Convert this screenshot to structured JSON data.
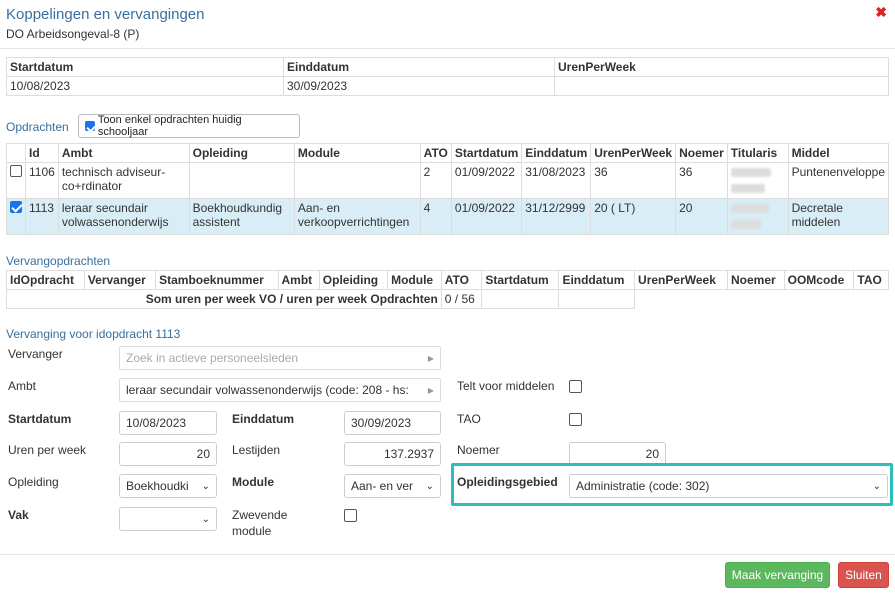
{
  "header": {
    "title": "Koppelingen en vervangingen",
    "subtitle": "DO Arbeidsongeval-8 (P)"
  },
  "period": {
    "columns": [
      "Startdatum",
      "Einddatum",
      "UrenPerWeek"
    ],
    "row": [
      "10/08/2023",
      "30/09/2023",
      ""
    ]
  },
  "opdrachten": {
    "heading": "Opdrachten",
    "filter_label": "Toon enkel opdrachten huidig schooljaar",
    "filter_checked": true,
    "columns": [
      "",
      "Id",
      "Ambt",
      "Opleiding",
      "Module",
      "ATO",
      "Startdatum",
      "Einddatum",
      "UrenPerWeek",
      "Noemer",
      "Titularis",
      "Middel"
    ],
    "rows": [
      {
        "checked": false,
        "id": "1106",
        "ambt": "technisch adviseur-co+rdinator",
        "opleiding": "",
        "module": "",
        "ato": "2",
        "start": "01/09/2022",
        "eind": "31/08/2023",
        "uren": "36",
        "noemer": "36",
        "titularis": "",
        "middel": "Puntenenveloppe"
      },
      {
        "checked": true,
        "id": "1113",
        "ambt": "leraar secundair volwassenonderwijs",
        "opleiding": "Boekhoudkundig assistent",
        "module": "Aan- en verkoopverrichtingen",
        "ato": "4",
        "start": "01/09/2022",
        "eind": "31/12/2999",
        "uren": "20 ( LT)",
        "noemer": "20",
        "titularis": "",
        "middel": "Decretale middelen"
      }
    ]
  },
  "vervangopdrachten": {
    "heading": "Vervangopdrachten",
    "columns": [
      "IdOpdracht",
      "Vervanger",
      "Stamboeknummer",
      "Ambt",
      "Opleiding",
      "Module",
      "ATO",
      "Startdatum",
      "Einddatum",
      "UrenPerWeek",
      "Noemer",
      "OOMcode",
      "TAO"
    ],
    "sum_label": "Som uren per week VO / uren per week Opdrachten",
    "sum_value": "0 / 56"
  },
  "form": {
    "heading": "Vervanging voor idopdracht 1113",
    "vervanger_label": "Vervanger",
    "vervanger_placeholder": "Zoek in actieve personeelsleden",
    "ambt_label": "Ambt",
    "ambt_value": "leraar secundair volwassenonderwijs (code: 208 - hs:",
    "telt_label": "Telt voor middelen",
    "startdatum_label": "Startdatum",
    "startdatum_value": "10/08/2023",
    "einddatum_label": "Einddatum",
    "einddatum_value": "30/09/2023",
    "tao_label": "TAO",
    "uren_label": "Uren per week",
    "uren_value": "20",
    "lestijden_label": "Lestijden",
    "lestijden_value": "137.2937",
    "noemer_label": "Noemer",
    "noemer_value": "20",
    "opleiding_label": "Opleiding",
    "opleiding_value": "Boekhoudki",
    "module_label": "Module",
    "module_value": "Aan- en ver",
    "opleidingsgebied_label": "Opleidingsgebied",
    "opleidingsgebied_value": "Administratie (code: 302)",
    "vak_label": "Vak",
    "vak_value": "",
    "zwevende_label_1": "Zwevende",
    "zwevende_label_2": "module"
  },
  "footer": {
    "primary": "Maak vervanging",
    "secondary": "Sluiten"
  },
  "colors": {
    "accent": "#3a6f9f",
    "highlight": "#2ebdbd",
    "primary_btn": "#5cb85c",
    "danger_btn": "#d9534f",
    "selected_row": "#d9edf7"
  }
}
